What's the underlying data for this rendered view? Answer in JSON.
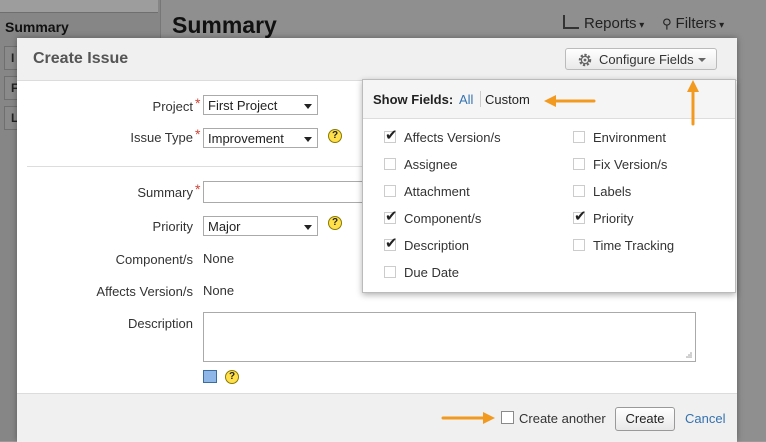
{
  "background": {
    "sidebar_heading": "Summary",
    "row_letters": [
      "I",
      "F",
      "L"
    ],
    "page_title": "Summary",
    "reports_label": "Reports",
    "filters_label": "Filters"
  },
  "dialog": {
    "title": "Create Issue",
    "configure_label": "Configure Fields",
    "fields": {
      "project_label": "Project",
      "project_value": "First Project",
      "issue_type_label": "Issue Type",
      "issue_type_value": "Improvement",
      "summary_label": "Summary",
      "summary_value": "",
      "priority_label": "Priority",
      "priority_value": "Major",
      "components_label": "Component/s",
      "components_value": "None",
      "affects_label": "Affects Version/s",
      "affects_value": "None",
      "description_label": "Description",
      "description_value": ""
    },
    "help_glyph": "?",
    "footer": {
      "create_another_label": "Create another",
      "create_another_checked": false,
      "create_label": "Create",
      "cancel_label": "Cancel"
    }
  },
  "show_fields": {
    "title": "Show Fields:",
    "all_label": "All",
    "custom_label": "Custom",
    "left_column": [
      {
        "label": "Affects Version/s",
        "checked": true
      },
      {
        "label": "Assignee",
        "checked": false
      },
      {
        "label": "Attachment",
        "checked": false
      },
      {
        "label": "Component/s",
        "checked": true
      },
      {
        "label": "Description",
        "checked": true
      },
      {
        "label": "Due Date",
        "checked": false
      }
    ],
    "right_column": [
      {
        "label": "Environment",
        "checked": false
      },
      {
        "label": "Fix Version/s",
        "checked": false
      },
      {
        "label": "Labels",
        "checked": false
      },
      {
        "label": "Priority",
        "checked": true
      },
      {
        "label": "Time Tracking",
        "checked": false
      }
    ],
    "check_glyph": "✔"
  },
  "colors": {
    "accent_link": "#3572b0",
    "required": "#d04437",
    "annotation_arrow": "#f29a1f"
  }
}
